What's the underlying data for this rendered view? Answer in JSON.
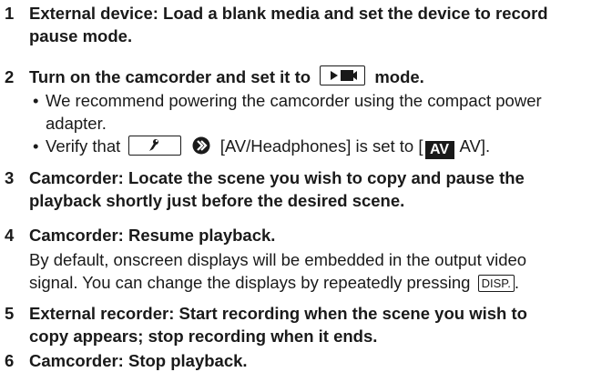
{
  "steps": [
    {
      "number": "1",
      "head_line1": "External device: Load a blank media and set the device to record",
      "head_line2": "pause mode."
    },
    {
      "number": "2",
      "head_before_icon": "Turn on the camcorder and set it to",
      "head_icon": "playback-mode-icon",
      "head_after_icon": "mode.",
      "bullets": [
        {
          "line1": "We recommend powering the camcorder using the compact power",
          "line2": "adapter."
        },
        {
          "before_icon": "Verify that",
          "setup_icon": "setup-menu-icon",
          "arrow_icon": "double-chevron-right-icon",
          "menu_item": "[AV/Headphones] is set to [",
          "av_badge": "AV",
          "option_text": "AV]."
        }
      ]
    },
    {
      "number": "3",
      "head_line1": "Camcorder: Locate the scene you wish to copy and pause the",
      "head_line2": "playback shortly just before the desired scene."
    },
    {
      "number": "4",
      "head_line1": "Camcorder: Resume playback.",
      "para_line1": "By default, onscreen displays will be embedded in the output video",
      "para_line2_before_key": "signal. You can change the displays by repeatedly pressing",
      "disp_key": "DISP.",
      "para_line2_end": "."
    },
    {
      "number": "5",
      "head_line1": "External recorder: Start recording when the scene you wish to",
      "head_line2": "copy appears; stop recording when it ends."
    },
    {
      "number": "6",
      "head_line1": "Camcorder: Stop playback."
    }
  ]
}
